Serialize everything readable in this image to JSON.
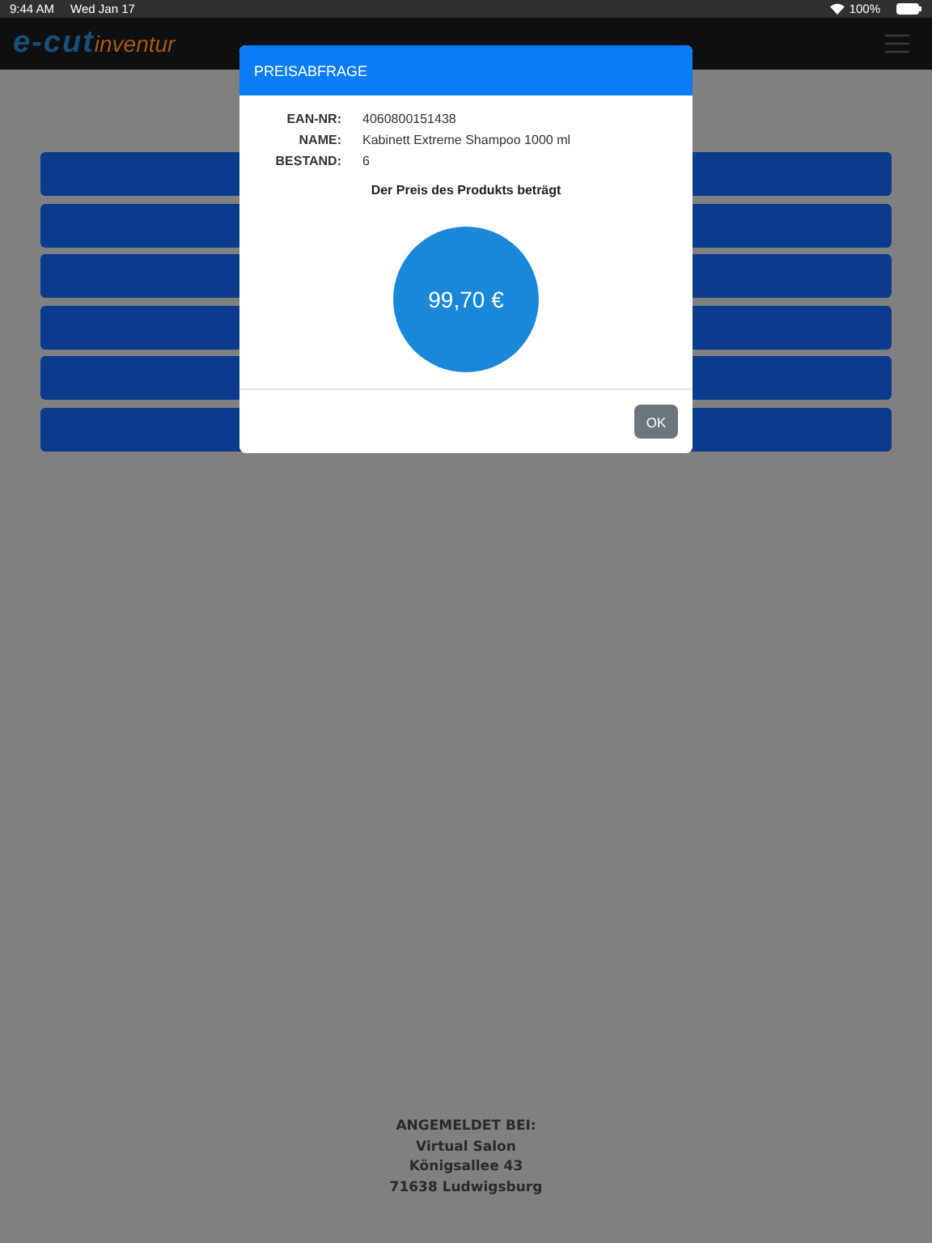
{
  "status_bar": {
    "time": "9:44 AM",
    "date": "Wed Jan 17",
    "battery": "100%"
  },
  "header": {
    "logo": [
      "e-cut",
      "inventur"
    ]
  },
  "footer": {
    "lines": [
      "ANGEMELDET BEI:",
      "Virtual Salon",
      "Königsallee 43",
      "71638 Ludwigsburg"
    ]
  },
  "dialog": {
    "title": "PREISABFRAGE",
    "fields": [
      {
        "label": "EAN-NR:",
        "value": "4060800151438"
      },
      {
        "label": "NAME:",
        "value": "Kabinett Extreme Shampoo 1000 ml"
      },
      {
        "label": "BESTAND:",
        "value": "6"
      }
    ],
    "caption": "Der Preis des Produkts beträgt",
    "price": "99,70 €",
    "buttons": [
      "OK"
    ]
  }
}
